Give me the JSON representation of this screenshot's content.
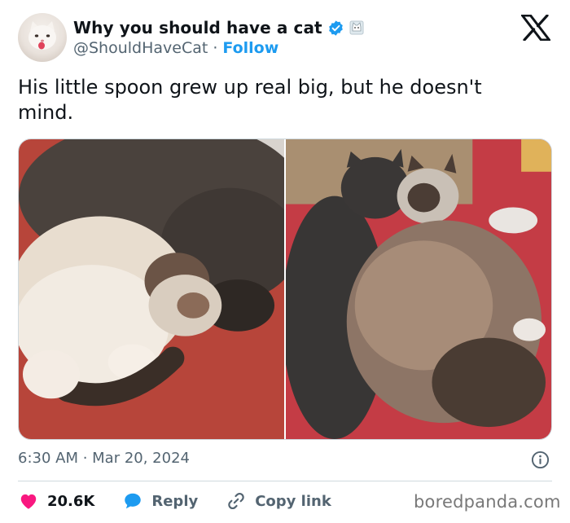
{
  "author": {
    "display_name": "Why you should have a cat",
    "handle": "@ShouldHaveCat",
    "separator": "·",
    "follow_label": "Follow"
  },
  "tweet": {
    "text": "His little spoon grew up real big, but he doesn't mind.",
    "timestamp": "6:30 AM · Mar 20, 2024"
  },
  "actions": {
    "likes": "20.6K",
    "reply_label": "Reply",
    "copy_link_label": "Copy link"
  },
  "watermark": "boredpanda.com",
  "colors": {
    "accent": "#1d9bf0",
    "like": "#f91880",
    "text": "#0f1419",
    "muted": "#536471",
    "border": "#cfd9de"
  },
  "icons": {
    "verified": "verified-badge-icon",
    "platform": "x-logo-icon",
    "info": "info-icon",
    "like": "heart-icon",
    "reply": "speech-bubble-icon",
    "copy_link": "link-icon"
  }
}
